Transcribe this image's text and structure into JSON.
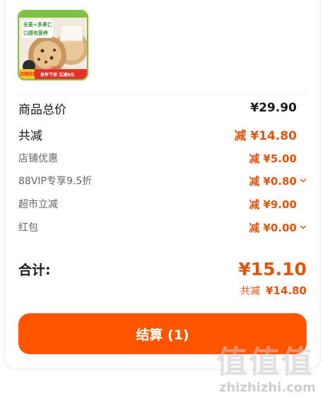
{
  "product": {
    "image_texts": [
      "全麦+多果仁",
      "口感有营养",
      "店铺优惠",
      "一次购齐",
      "单件下单 立减9元"
    ]
  },
  "summary": {
    "goods_total": {
      "label": "商品总价",
      "value": "¥29.90"
    },
    "total_discount": {
      "label": "共减",
      "value": "减 ¥14.80"
    },
    "discounts": [
      {
        "label": "店铺优惠",
        "value": "减 ¥5.00",
        "has_chevron": false
      },
      {
        "label": "88VIP专享9.5折",
        "value": "减 ¥0.80",
        "has_chevron": true
      },
      {
        "label": "超市立减",
        "value": "减 ¥9.00",
        "has_chevron": false
      },
      {
        "label": "红包",
        "value": "减 ¥0.00",
        "has_chevron": true
      }
    ]
  },
  "total": {
    "label": "合计:",
    "value": "¥15.10"
  },
  "saving": {
    "label": "共减",
    "value": "¥14.80"
  },
  "checkout": {
    "label": "结算 (1)"
  },
  "watermark": {
    "chars": "值值值",
    "site": "zhizhizhi.com"
  },
  "colors": {
    "accent": "#ff5500",
    "discount": "#e25511",
    "image_border": "#7fc241"
  }
}
